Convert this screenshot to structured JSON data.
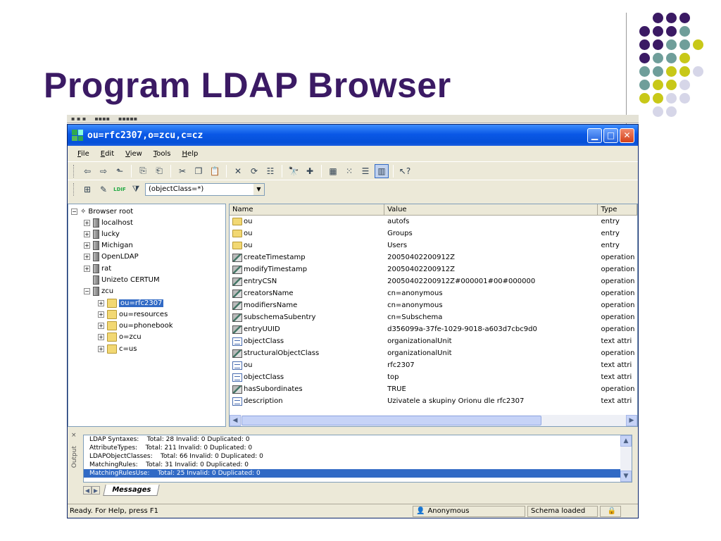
{
  "slide": {
    "title": "Program LDAP Browser",
    "dot_colors": {
      "purple": "#3b1a64",
      "teal": "#6f9e9a",
      "olive": "#c8c818",
      "lavender": "#d6d6e8"
    }
  },
  "window": {
    "title": "ou=rfc2307,o=zcu,c=cz",
    "menu": [
      "File",
      "Edit",
      "View",
      "Tools",
      "Help"
    ],
    "filter_value": "(objectClass=*)"
  },
  "tree": {
    "root": "Browser root",
    "servers": [
      "localhost",
      "lucky",
      "Michigan",
      "OpenLDAP",
      "rat",
      "Unizeto CERTUM",
      "zcu"
    ],
    "zcu_children": [
      "ou=rfc2307",
      "ou=resources",
      "ou=phonebook",
      "o=zcu",
      "c=us"
    ]
  },
  "grid": {
    "headers": [
      "Name",
      "Value",
      "Type"
    ],
    "rows": [
      {
        "icon": "folder",
        "name": "ou",
        "value": "autofs",
        "type": "entry"
      },
      {
        "icon": "folder",
        "name": "ou",
        "value": "Groups",
        "type": "entry"
      },
      {
        "icon": "folder",
        "name": "ou",
        "value": "Users",
        "type": "entry"
      },
      {
        "icon": "op",
        "name": "createTimestamp",
        "value": "20050402200912Z",
        "type": "operation"
      },
      {
        "icon": "op",
        "name": "modifyTimestamp",
        "value": "20050402200912Z",
        "type": "operation"
      },
      {
        "icon": "op",
        "name": "entryCSN",
        "value": "20050402200912Z#000001#00#000000",
        "type": "operation"
      },
      {
        "icon": "op",
        "name": "creatorsName",
        "value": "cn=anonymous",
        "type": "operation"
      },
      {
        "icon": "op",
        "name": "modifiersName",
        "value": "cn=anonymous",
        "type": "operation"
      },
      {
        "icon": "op",
        "name": "subschemaSubentry",
        "value": "cn=Subschema",
        "type": "operation"
      },
      {
        "icon": "op",
        "name": "entryUUID",
        "value": "d356099a-37fe-1029-9018-a603d7cbc9d0",
        "type": "operation"
      },
      {
        "icon": "attr",
        "name": "objectClass",
        "value": "organizationalUnit",
        "type": "text attri"
      },
      {
        "icon": "op",
        "name": "structuralObjectClass",
        "value": "organizationalUnit",
        "type": "operation"
      },
      {
        "icon": "attr",
        "name": "ou",
        "value": "rfc2307",
        "type": "text attri"
      },
      {
        "icon": "attr",
        "name": "objectClass",
        "value": "top",
        "type": "text attri"
      },
      {
        "icon": "op",
        "name": "hasSubordinates",
        "value": "TRUE",
        "type": "operation"
      },
      {
        "icon": "attr",
        "name": "description",
        "value": "Uzivatele a skupiny Orionu dle rfc2307",
        "type": "text attri"
      }
    ]
  },
  "output": {
    "label": "Output",
    "lines": [
      "LDAP Syntaxes:    Total: 28 Invalid: 0 Duplicated: 0",
      "AttributeTypes:    Total: 211 Invalid: 0 Duplicated: 0",
      "LDAPObjectClasses:    Total: 66 Invalid: 0 Duplicated: 0",
      "MatchingRules:    Total: 31 Invalid: 0 Duplicated: 0",
      "MatchingRulesUse:    Total: 25 Invalid: 0 Duplicated: 0"
    ],
    "tab_label": "Messages"
  },
  "status": {
    "message": "Ready. For Help, press F1",
    "user": "Anonymous",
    "schema": "Schema loaded"
  }
}
